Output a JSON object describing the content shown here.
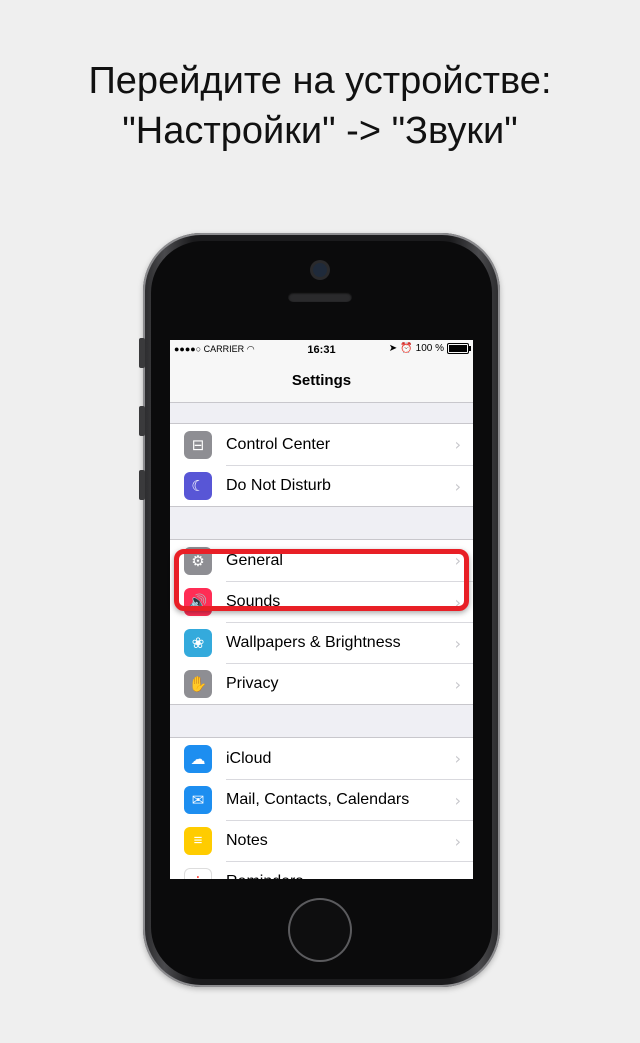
{
  "instruction": {
    "line1": "Перейдите на устройстве:",
    "line2": "\"Настройки\" -> \"Звуки\""
  },
  "status_bar": {
    "carrier": "●●●●○ CARRIER",
    "time": "16:31",
    "battery": "100 %"
  },
  "nav": {
    "title": "Settings"
  },
  "groups": [
    [
      {
        "label": "Control Center",
        "icon": "control-center-icon",
        "color": "#8e8e93"
      },
      {
        "label": "Do Not Disturb",
        "icon": "moon-icon",
        "color": "#5856d6"
      }
    ],
    [
      {
        "label": "General",
        "icon": "gear-icon",
        "color": "#8e8e93"
      },
      {
        "label": "Sounds",
        "icon": "speaker-icon",
        "color": "#ff2d55"
      },
      {
        "label": "Wallpapers & Brightness",
        "icon": "flower-icon",
        "color": "#34aadc"
      },
      {
        "label": "Privacy",
        "icon": "hand-icon",
        "color": "#8e8e93"
      }
    ],
    [
      {
        "label": "iCloud",
        "icon": "cloud-icon",
        "color": "#1d8ef0"
      },
      {
        "label": "Mail, Contacts, Calendars",
        "icon": "mail-icon",
        "color": "#1d8ef0"
      },
      {
        "label": "Notes",
        "icon": "notes-icon",
        "color": "#ffcc00"
      },
      {
        "label": "Reminders",
        "icon": "reminders-icon",
        "color": "#ffffff"
      }
    ]
  ],
  "highlighted_item": "Sounds",
  "highlight_color": "#e81f26"
}
